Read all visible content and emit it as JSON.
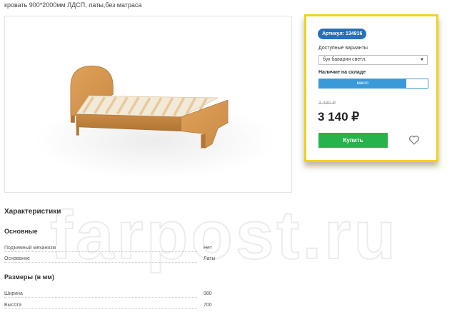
{
  "product": {
    "title": "кровать 900*2000мм ЛДСП, латы,без матраса",
    "image_alt": "bed-with-slats-photo"
  },
  "card": {
    "sku_label": "Артикул: 134916",
    "variants_label": "Доступные варианты",
    "variant_selected": "бук бавария светл.",
    "stock_label": "Наличие на складе",
    "stock_value": "много",
    "stock_level": 0.8,
    "old_price": "3 490 ₽",
    "price": "3 140 ₽",
    "buy_label": "Купить",
    "accent_color": "#f2d21c",
    "buy_color": "#27b34b",
    "stock_color": "#3a9ad9",
    "favorite_icon": "heart-icon"
  },
  "specs": {
    "title": "Характеристики",
    "groups": [
      {
        "title": "Основные",
        "rows": [
          {
            "label": "Подъемный механизм",
            "value": "Нет"
          },
          {
            "label": "Основание",
            "value": "Латы"
          }
        ]
      },
      {
        "title": "Размеры (в мм)",
        "rows": [
          {
            "label": "Ширина",
            "value": "980"
          },
          {
            "label": "Высота",
            "value": "700"
          }
        ]
      }
    ]
  },
  "watermark": "farpost.ru"
}
